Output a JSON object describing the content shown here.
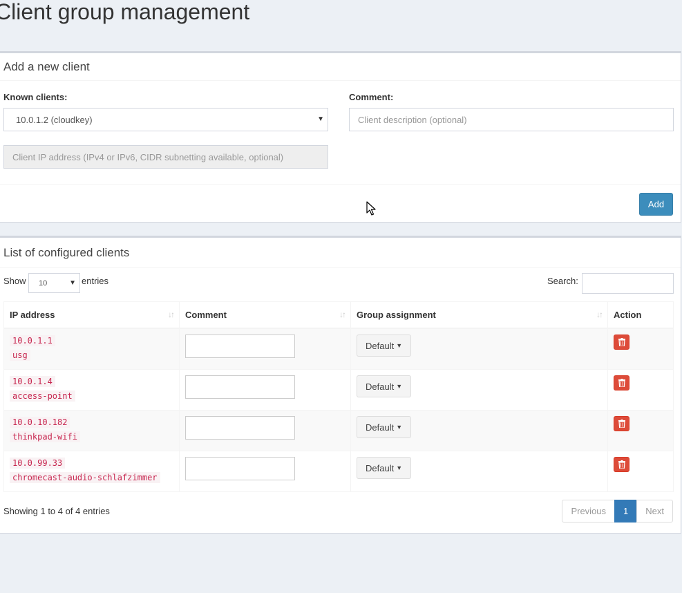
{
  "page": {
    "title": "Client group management"
  },
  "add_box": {
    "title": "Add a new client",
    "known_clients_label": "Known clients:",
    "known_clients_value": "10.0.1.2 (cloudkey)",
    "comment_label": "Comment:",
    "comment_placeholder": "Client description (optional)",
    "ip_placeholder": "Client IP address (IPv4 or IPv6, CIDR subnetting available, optional)",
    "add_button": "Add"
  },
  "list_box": {
    "title": "List of configured clients",
    "show_label": "Show",
    "show_value": "10",
    "entries_label": "entries",
    "search_label": "Search:",
    "columns": [
      "IP address",
      "Comment",
      "Group assignment",
      "Action"
    ],
    "rows": [
      {
        "ip": "10.0.1.1",
        "name": "usg",
        "group": "Default"
      },
      {
        "ip": "10.0.1.4",
        "name": "access-point",
        "group": "Default"
      },
      {
        "ip": "10.0.10.182",
        "name": "thinkpad-wifi",
        "group": "Default"
      },
      {
        "ip": "10.0.99.33",
        "name": "chromecast-audio-schlafzimmer",
        "group": "Default"
      }
    ],
    "info": "Showing 1 to 4 of 4 entries",
    "pagination": {
      "previous": "Previous",
      "current": "1",
      "next": "Next"
    }
  },
  "colors": {
    "primary": "#3c8dbc",
    "danger": "#dd4b39",
    "code": "#c7254e",
    "background": "#ecf0f5"
  }
}
